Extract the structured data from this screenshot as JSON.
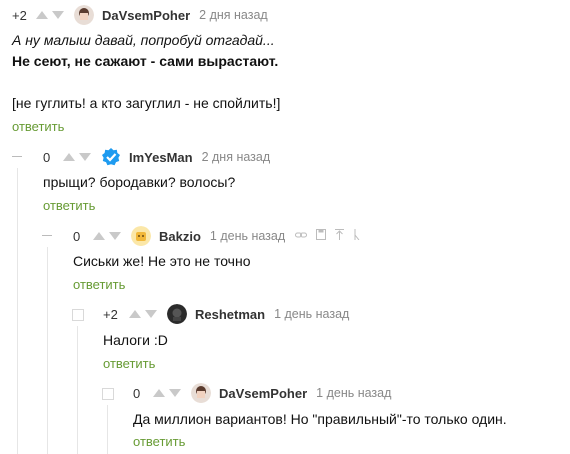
{
  "comments": [
    {
      "rating": "+2",
      "nick": "DaVsemPoher",
      "time": "2 дня назад",
      "lines": [
        "А ну малыш давай, попробуй отгадай...",
        "Не сеют, не сажают - сами вырастают.",
        "",
        "[не гуглить! а кто загуглил - не спойлить!]"
      ],
      "reply": "ответить"
    },
    {
      "rating": "0",
      "nick": "ImYesMan",
      "time": "2 дня назад",
      "text": "прыщи? бородавки? волосы?",
      "reply": "ответить"
    },
    {
      "rating": "0",
      "nick": "Bakzio",
      "time": "1 день назад",
      "text": "Сиськи же! Не это не точно",
      "reply": "ответить"
    },
    {
      "rating": "+2",
      "nick": "Reshetman",
      "time": "1 день назад",
      "text": "Налоги :D",
      "reply": "ответить"
    },
    {
      "rating": "0",
      "nick": "DaVsemPoher",
      "time": "1 день назад",
      "text": "Да миллион вариантов! Но \"правильный\"-то только один.",
      "reply": "ответить"
    }
  ],
  "colors": {
    "accent": "#679b34",
    "verified": "#1e9bf0"
  }
}
